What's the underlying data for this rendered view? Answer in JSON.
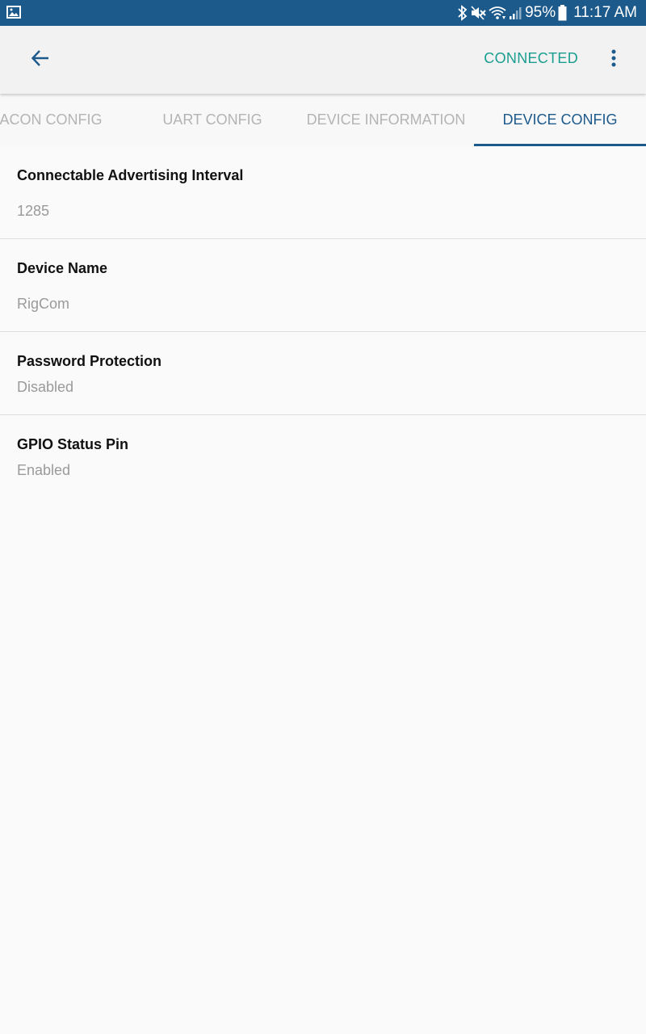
{
  "status_bar": {
    "battery_percent": "95%",
    "time": "11:17 AM",
    "icons": [
      "gallery-icon",
      "bluetooth-icon",
      "mute-icon",
      "wifi-icon",
      "signal-icon",
      "battery-icon"
    ]
  },
  "app_bar": {
    "back_icon": "arrow-left-icon",
    "connection_status": "CONNECTED",
    "menu_icon": "more-vert-icon"
  },
  "tabs": [
    {
      "label": "ACON CONFIG",
      "active": false
    },
    {
      "label": "UART CONFIG",
      "active": false
    },
    {
      "label": "DEVICE INFORMATION",
      "active": false
    },
    {
      "label": "DEVICE CONFIG",
      "active": true
    }
  ],
  "settings": [
    {
      "title": "Connectable Advertising Interval",
      "value": "1285"
    },
    {
      "title": "Device Name",
      "value": "RigCom"
    },
    {
      "title": "Password Protection",
      "value": "Disabled"
    },
    {
      "title": "GPIO Status Pin",
      "value": "Enabled"
    }
  ],
  "colors": {
    "primary": "#1d5a8c",
    "accent": "#1a9e8f",
    "inactive_tab": "#b4b4b4",
    "value_text": "#9a9a9a",
    "background": "#fafafa"
  }
}
